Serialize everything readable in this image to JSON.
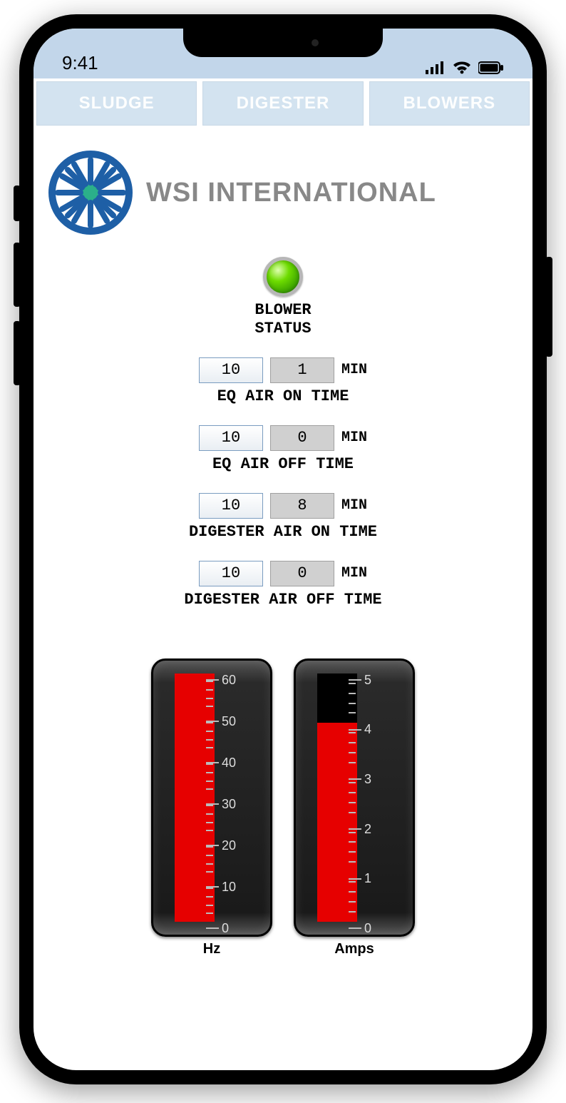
{
  "status_bar": {
    "time": "9:41"
  },
  "tabs": [
    "SLUDGE",
    "DIGESTER",
    "BLOWERS"
  ],
  "company": "WSI INTERNATIONAL",
  "blower_status": {
    "label_line1": "BLOWER",
    "label_line2": "STATUS",
    "on": true
  },
  "params": [
    {
      "set": "10",
      "actual": "1",
      "unit": "MIN",
      "label": "EQ AIR ON TIME"
    },
    {
      "set": "10",
      "actual": "0",
      "unit": "MIN",
      "label": "EQ AIR OFF TIME"
    },
    {
      "set": "10",
      "actual": "8",
      "unit": "MIN",
      "label": "DIGESTER AIR ON TIME"
    },
    {
      "set": "10",
      "actual": "0",
      "unit": "MIN",
      "label": "DIGESTER AIR OFF TIME"
    }
  ],
  "chart_data": [
    {
      "type": "bar",
      "title": "Hz",
      "ylim": [
        0,
        60
      ],
      "ticks": [
        0,
        10,
        20,
        30,
        40,
        50,
        60
      ],
      "value": 60
    },
    {
      "type": "bar",
      "title": "Amps",
      "ylim": [
        0,
        5
      ],
      "ticks": [
        0,
        1,
        2,
        3,
        4,
        5
      ],
      "value": 4
    }
  ]
}
